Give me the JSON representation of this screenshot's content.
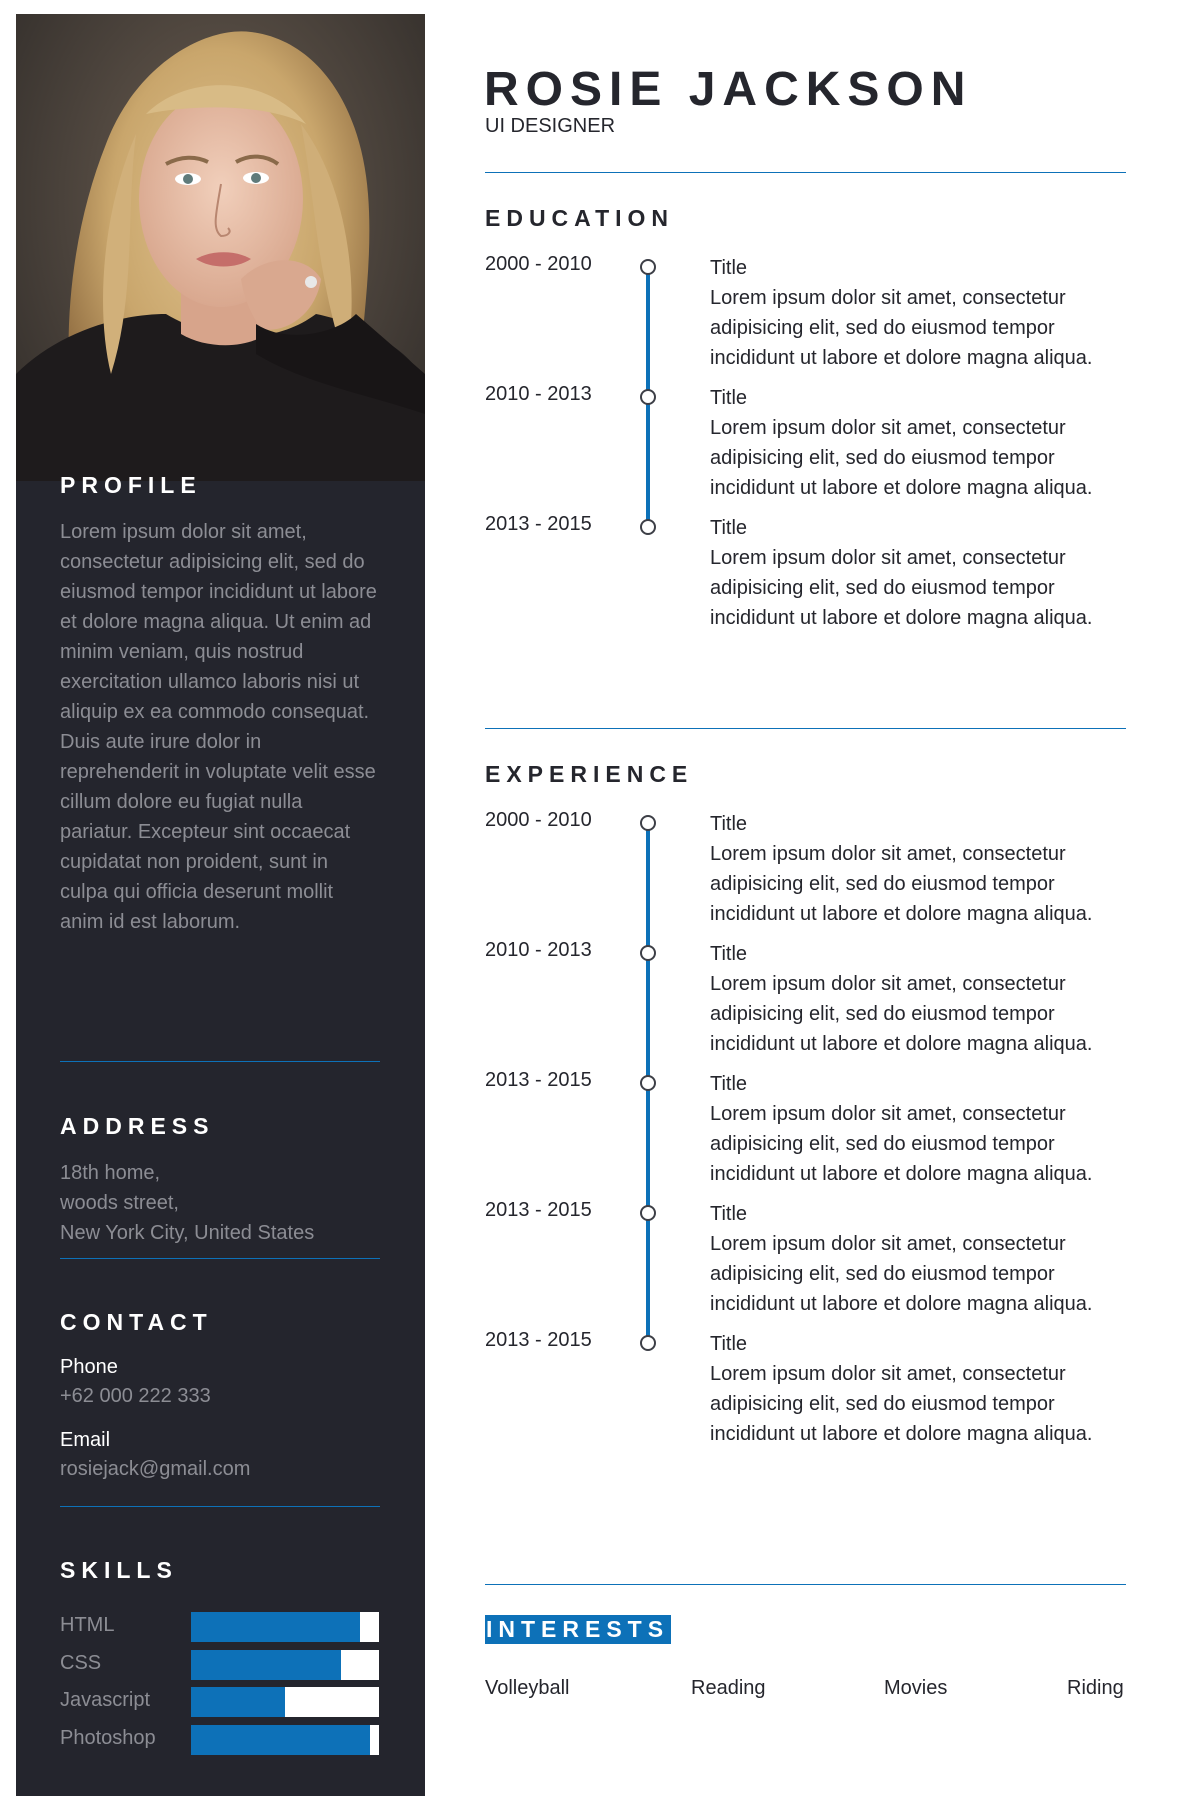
{
  "header": {
    "name": "ROSIE JACKSON",
    "role": "UI DESIGNER"
  },
  "sidebar": {
    "photo_alt": "portrait-photo",
    "profile": {
      "heading": "PROFILE",
      "text": "Lorem ipsum dolor sit amet, consectetur adipisicing elit, sed do eiusmod tempor incididunt ut labore et dolore magna aliqua. Ut enim ad minim veniam, quis nostrud exercitation ullamco laboris nisi ut aliquip ex ea commodo consequat. Duis aute irure dolor in reprehenderit in voluptate velit esse cillum dolore eu fugiat nulla pariatur. Excepteur sint occaecat cupidatat non proident, sunt in culpa qui officia deserunt mollit anim id est laborum."
    },
    "address": {
      "heading": "ADDRESS",
      "lines": [
        "18th home,",
        "woods street,",
        "New York City, United States"
      ]
    },
    "contact": {
      "heading": "CONTACT",
      "phone_label": "Phone",
      "phone_value": "+62 000 222 333",
      "email_label": "Email",
      "email_value": "rosiejack@gmail.com"
    },
    "skills": {
      "heading": "SKILLS",
      "items": [
        {
          "name": "HTML",
          "level": 0.9
        },
        {
          "name": "CSS",
          "level": 0.8
        },
        {
          "name": "Javascript",
          "level": 0.5
        },
        {
          "name": "Photoshop",
          "level": 0.95
        }
      ]
    }
  },
  "education": {
    "heading": "EDUCATION",
    "items": [
      {
        "date": "2000 - 2010",
        "title": "Title",
        "desc": [
          "Lorem ipsum dolor sit amet, consectetur",
          "adipisicing elit, sed do eiusmod tempor",
          "incididunt ut labore et dolore magna aliqua."
        ]
      },
      {
        "date": "2010 - 2013",
        "title": "Title",
        "desc": [
          "Lorem ipsum dolor sit amet, consectetur",
          "adipisicing elit, sed do eiusmod tempor",
          "incididunt ut labore et dolore magna aliqua."
        ]
      },
      {
        "date": "2013 - 2015",
        "title": "Title",
        "desc": [
          "Lorem ipsum dolor sit amet, consectetur",
          "adipisicing elit, sed do eiusmod tempor",
          "incididunt ut labore et dolore magna aliqua."
        ]
      }
    ]
  },
  "experience": {
    "heading": "EXPERIENCE",
    "items": [
      {
        "date": "2000 - 2010",
        "title": "Title",
        "desc": [
          "Lorem ipsum dolor sit amet, consectetur",
          "adipisicing elit, sed do eiusmod tempor",
          "incididunt ut labore et dolore magna aliqua."
        ]
      },
      {
        "date": "2010 - 2013",
        "title": "Title",
        "desc": [
          "Lorem ipsum dolor sit amet, consectetur",
          "adipisicing elit, sed do eiusmod tempor",
          "incididunt ut labore et dolore magna aliqua."
        ]
      },
      {
        "date": "2013 - 2015",
        "title": "Title",
        "desc": [
          "Lorem ipsum dolor sit amet, consectetur",
          "adipisicing elit, sed do eiusmod tempor",
          "incididunt ut labore et dolore magna aliqua."
        ]
      },
      {
        "date": "2013 - 2015",
        "title": "Title",
        "desc": [
          "Lorem ipsum dolor sit amet, consectetur",
          "adipisicing elit, sed do eiusmod tempor",
          "incididunt ut labore et dolore magna aliqua."
        ]
      },
      {
        "date": "2013 - 2015",
        "title": "Title",
        "desc": [
          "Lorem ipsum dolor sit amet, consectetur",
          "adipisicing elit, sed do eiusmod tempor",
          "incididunt ut labore et dolore magna aliqua."
        ]
      }
    ]
  },
  "interests": {
    "heading": "INTERESTS",
    "items": [
      "Volleyball",
      "Reading",
      "Movies",
      "Riding"
    ]
  },
  "colors": {
    "sidebar_bg": "#24252d",
    "accent": "#0d71b8",
    "text_dark": "#25262d",
    "text_muted": "#8c8d94"
  }
}
